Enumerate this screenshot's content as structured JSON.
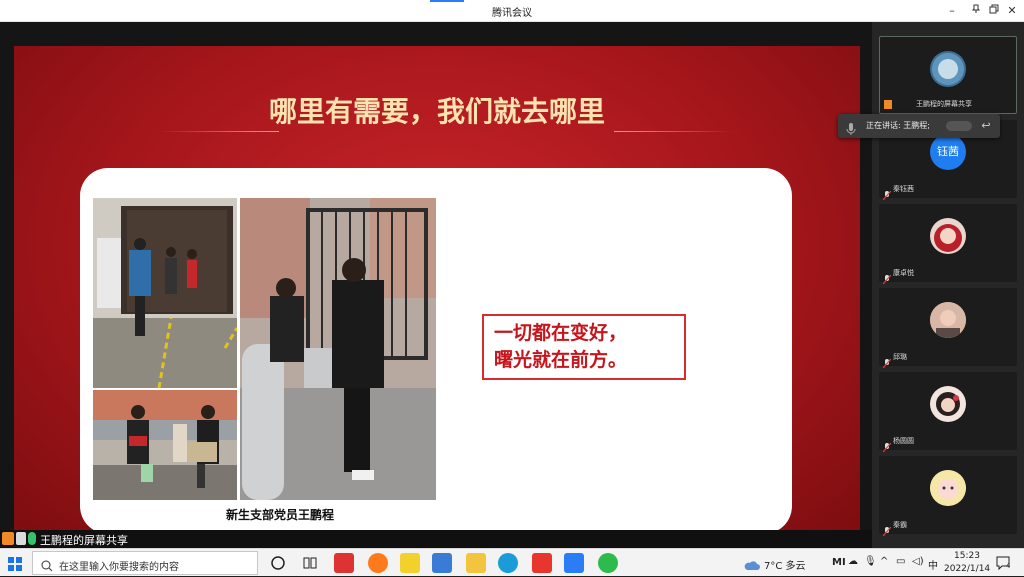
{
  "window": {
    "title": "腾讯会议"
  },
  "slide": {
    "heading": "哪里有需要，我们就去哪里",
    "caption": "新生支部党员王鹏程",
    "quote_lines": [
      "一切都在变好，",
      "曙光就在前方。"
    ]
  },
  "share_bar": {
    "label": "王鹏程的屏幕共享"
  },
  "speaking": {
    "label": "正在讲话: 王鹏程;"
  },
  "participants": [
    {
      "name": "王鹏程的屏幕共享"
    },
    {
      "name": "秦钰茜",
      "avatar_text": "钰茜"
    },
    {
      "name": "康卓悦"
    },
    {
      "name": "邱璐"
    },
    {
      "name": "杨圆圆"
    },
    {
      "name": "秦霸"
    }
  ],
  "taskbar": {
    "search_placeholder": "在这里输入你要搜索的内容",
    "weather": "7°C 多云",
    "ime": "中",
    "time": "15:23",
    "date": "2022/1/14",
    "notifications": "4"
  },
  "colors": {
    "slide_red": "#b0181e",
    "accent_blue": "#2b7cf7",
    "quote_red": "#c5161d"
  }
}
